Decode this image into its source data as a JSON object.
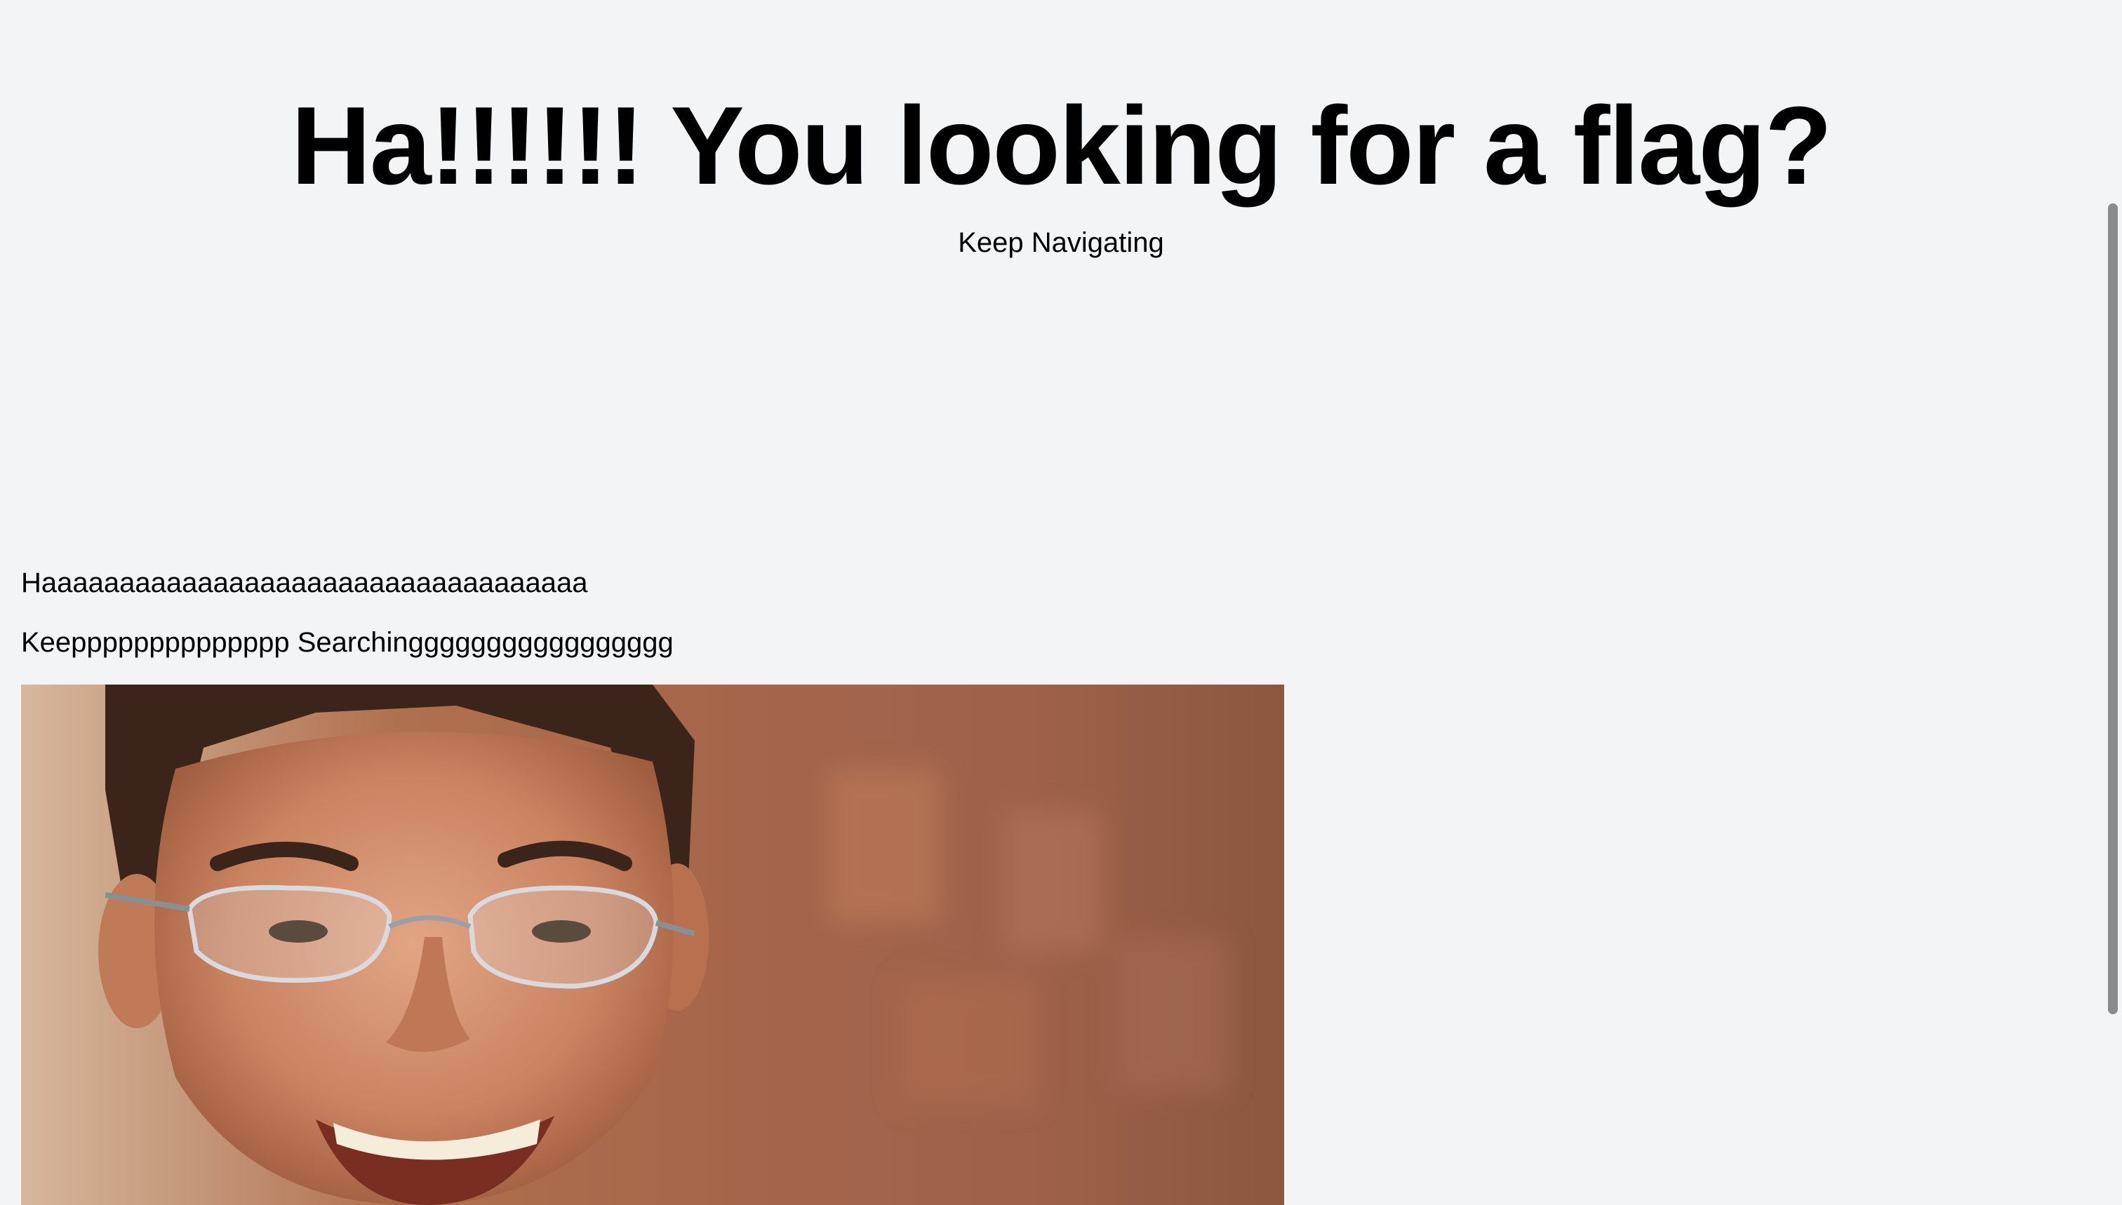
{
  "page": {
    "title": "Ha!!!!!! You looking for a flag?",
    "subtitle": "Keep Navigating",
    "paragraphs": [
      "Haaaaaaaaaaaaaaaaaaaaaaaaaaaaaaaaaaa",
      "Keepppppppppppppp Searchinggggggggggggggggg"
    ]
  },
  "photo": {
    "subject": "smiling man wearing rimless glasses"
  },
  "colors": {
    "background": "#f3f4f6",
    "text": "#000000",
    "scrollbar_thumb": "#8a8b8d"
  }
}
